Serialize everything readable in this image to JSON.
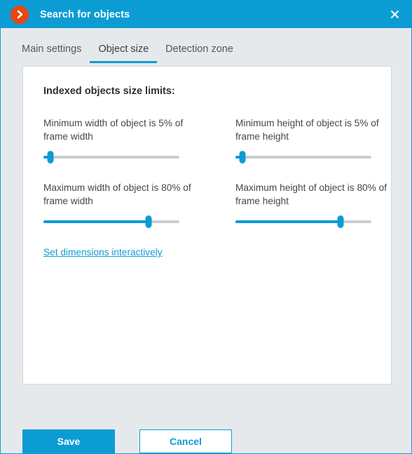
{
  "window": {
    "title": "Search for objects",
    "app_icon": "chevron-right-circle-icon",
    "close_icon": "close-icon",
    "accent_color": "#0c9cd4",
    "icon_color": "#e8470f"
  },
  "tabs": [
    {
      "label": "Main settings",
      "active": false
    },
    {
      "label": "Object size",
      "active": true
    },
    {
      "label": "Detection zone",
      "active": false
    }
  ],
  "panel": {
    "heading": "Indexed objects size limits:",
    "link_label": "Set dimensions interactively",
    "fields": [
      {
        "id": "min-width",
        "label": "Minimum width of object is 5% of frame width",
        "value": 5,
        "unit": "%",
        "min": 0,
        "max": 100
      },
      {
        "id": "min-height",
        "label": "Minimum height of object is 5% of frame height",
        "value": 5,
        "unit": "%",
        "min": 0,
        "max": 100
      },
      {
        "id": "max-width",
        "label": "Maximum width of object is 80% of frame width",
        "value": 80,
        "unit": "%",
        "min": 0,
        "max": 100
      },
      {
        "id": "max-height",
        "label": "Maximum height of object is 80% of frame height",
        "value": 80,
        "unit": "%",
        "min": 0,
        "max": 100
      }
    ]
  },
  "footer": {
    "save_label": "Save",
    "cancel_label": "Cancel"
  }
}
